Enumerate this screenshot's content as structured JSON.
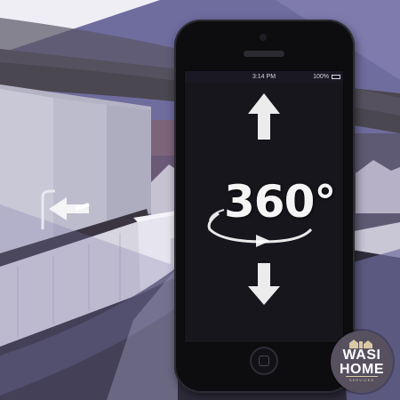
{
  "phone": {
    "status_time": "3:14 PM",
    "status_battery": "100%",
    "status_carrier": ""
  },
  "overlay": {
    "label_360": "360°"
  },
  "brand": {
    "line1": "WASI",
    "line2": "HOME",
    "tagline": "SERVICES",
    "badge_color": "#56505f",
    "accent_color": "#d9c9a6"
  },
  "icons": [
    "arrow-up-icon",
    "arrow-down-icon",
    "rotate-arrow-icon",
    "home-button-icon",
    "house-skyline-icon"
  ]
}
